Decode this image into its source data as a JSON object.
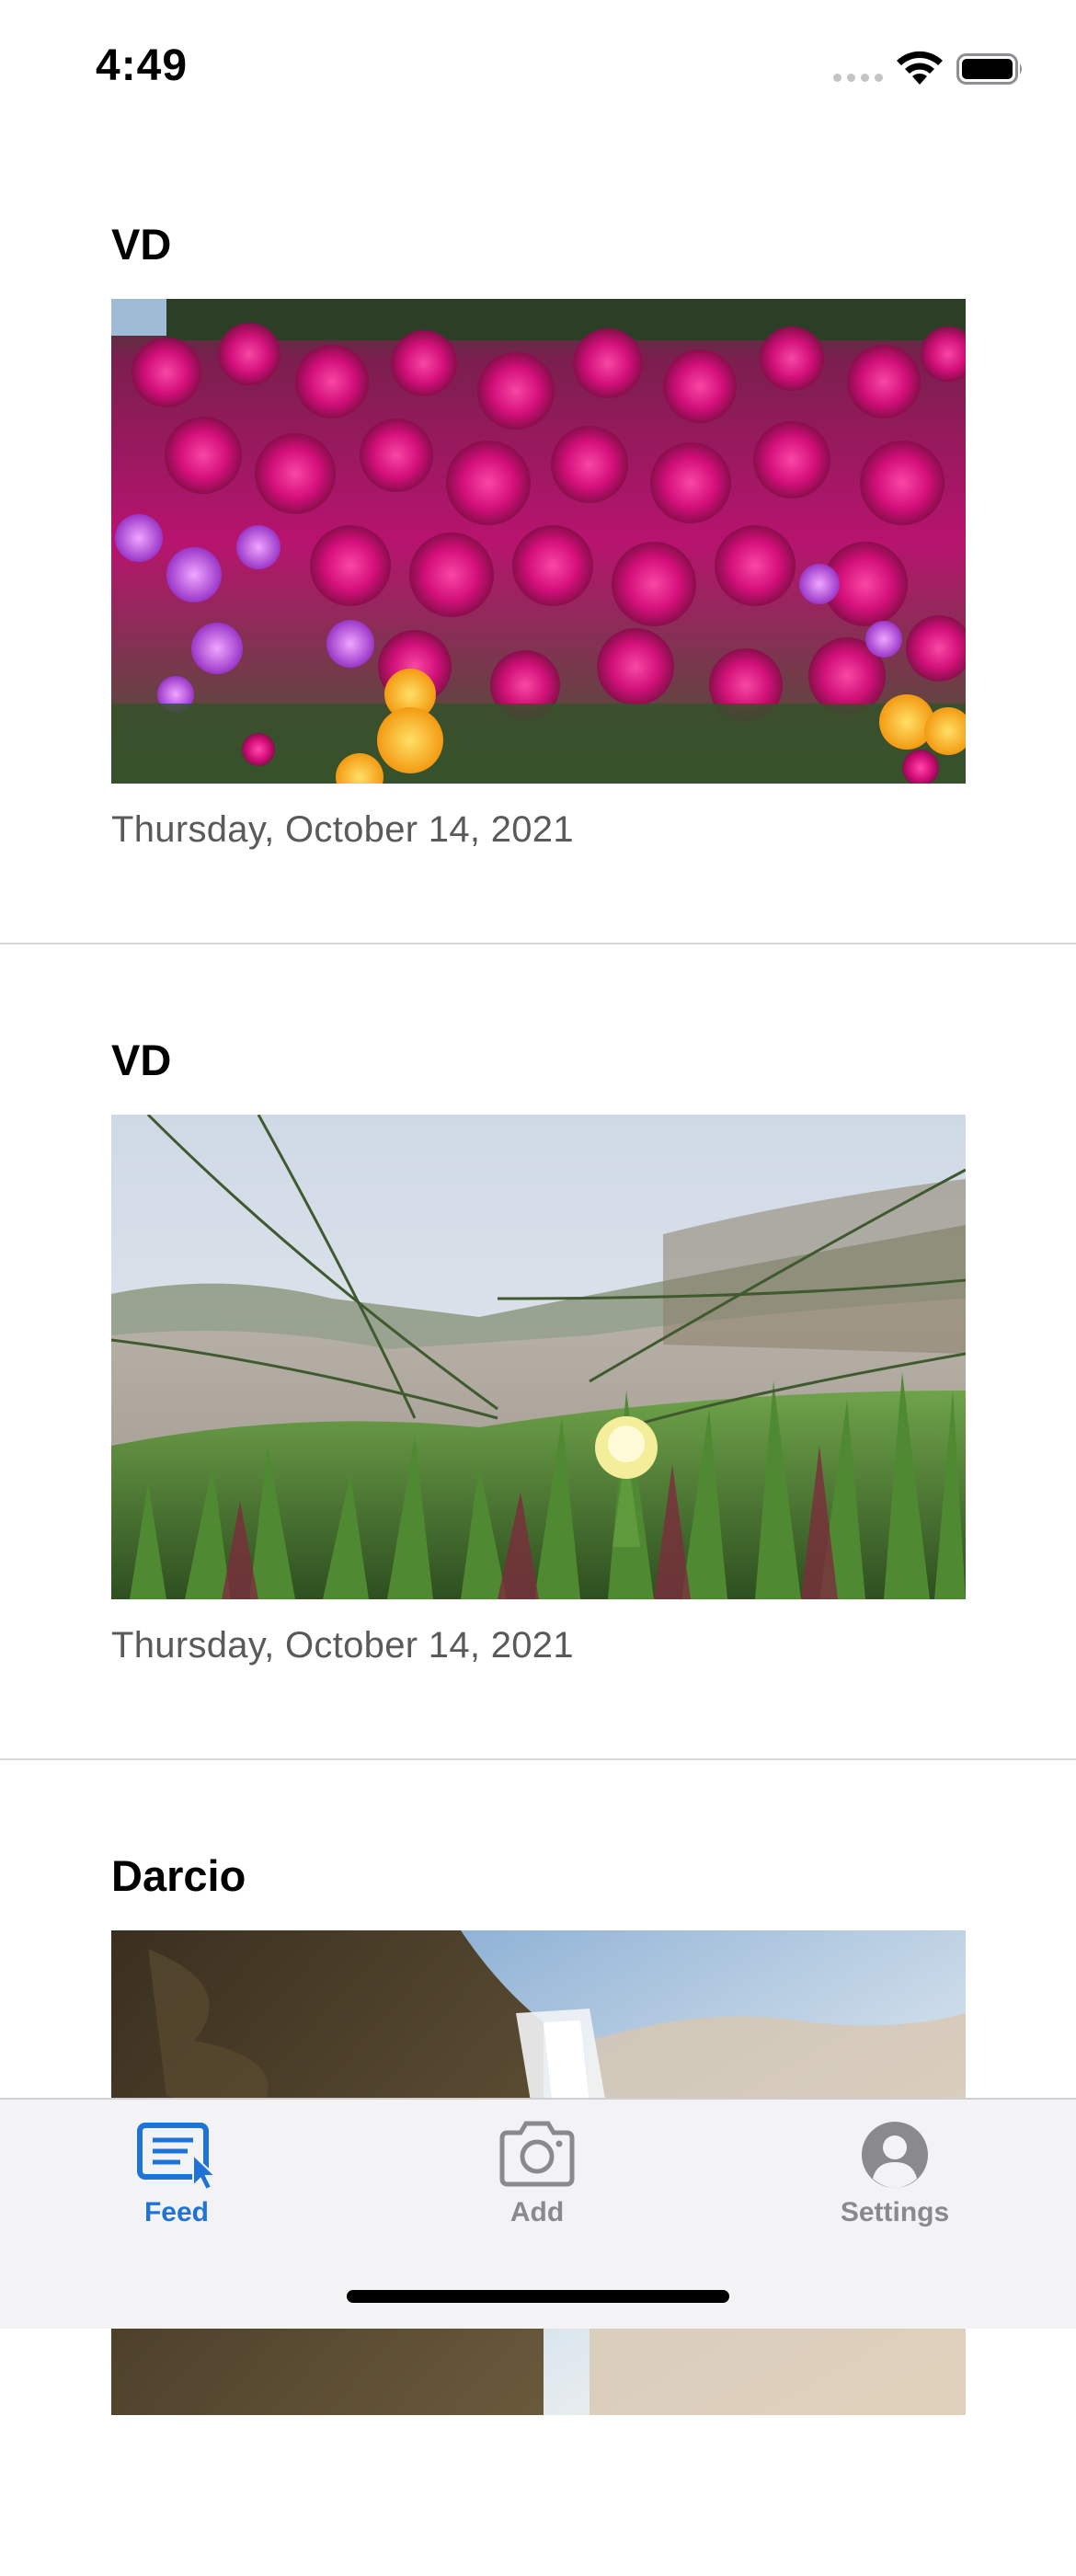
{
  "status_bar": {
    "time": "4:49"
  },
  "feed": {
    "posts": [
      {
        "author": "VD",
        "date": "Thursday, October 14, 2021",
        "photo": "magenta-flower-field"
      },
      {
        "author": "VD",
        "date": "Thursday, October 14, 2021",
        "photo": "beach-ice-plant"
      },
      {
        "author": "Darcio",
        "date": "",
        "photo": "waterfall-cliff"
      }
    ]
  },
  "tab_bar": {
    "tabs": [
      {
        "label": "Feed",
        "icon": "feed-icon",
        "active": true
      },
      {
        "label": "Add",
        "icon": "camera-icon",
        "active": false
      },
      {
        "label": "Settings",
        "icon": "person-circle-icon",
        "active": false
      }
    ]
  },
  "colors": {
    "accent": "#1e73d6",
    "inactive_tab": "#8a8a8e",
    "secondary_text": "#5a5a5c",
    "tab_bar_bg": "#f3f3f5",
    "divider": "#d7d7d9"
  }
}
